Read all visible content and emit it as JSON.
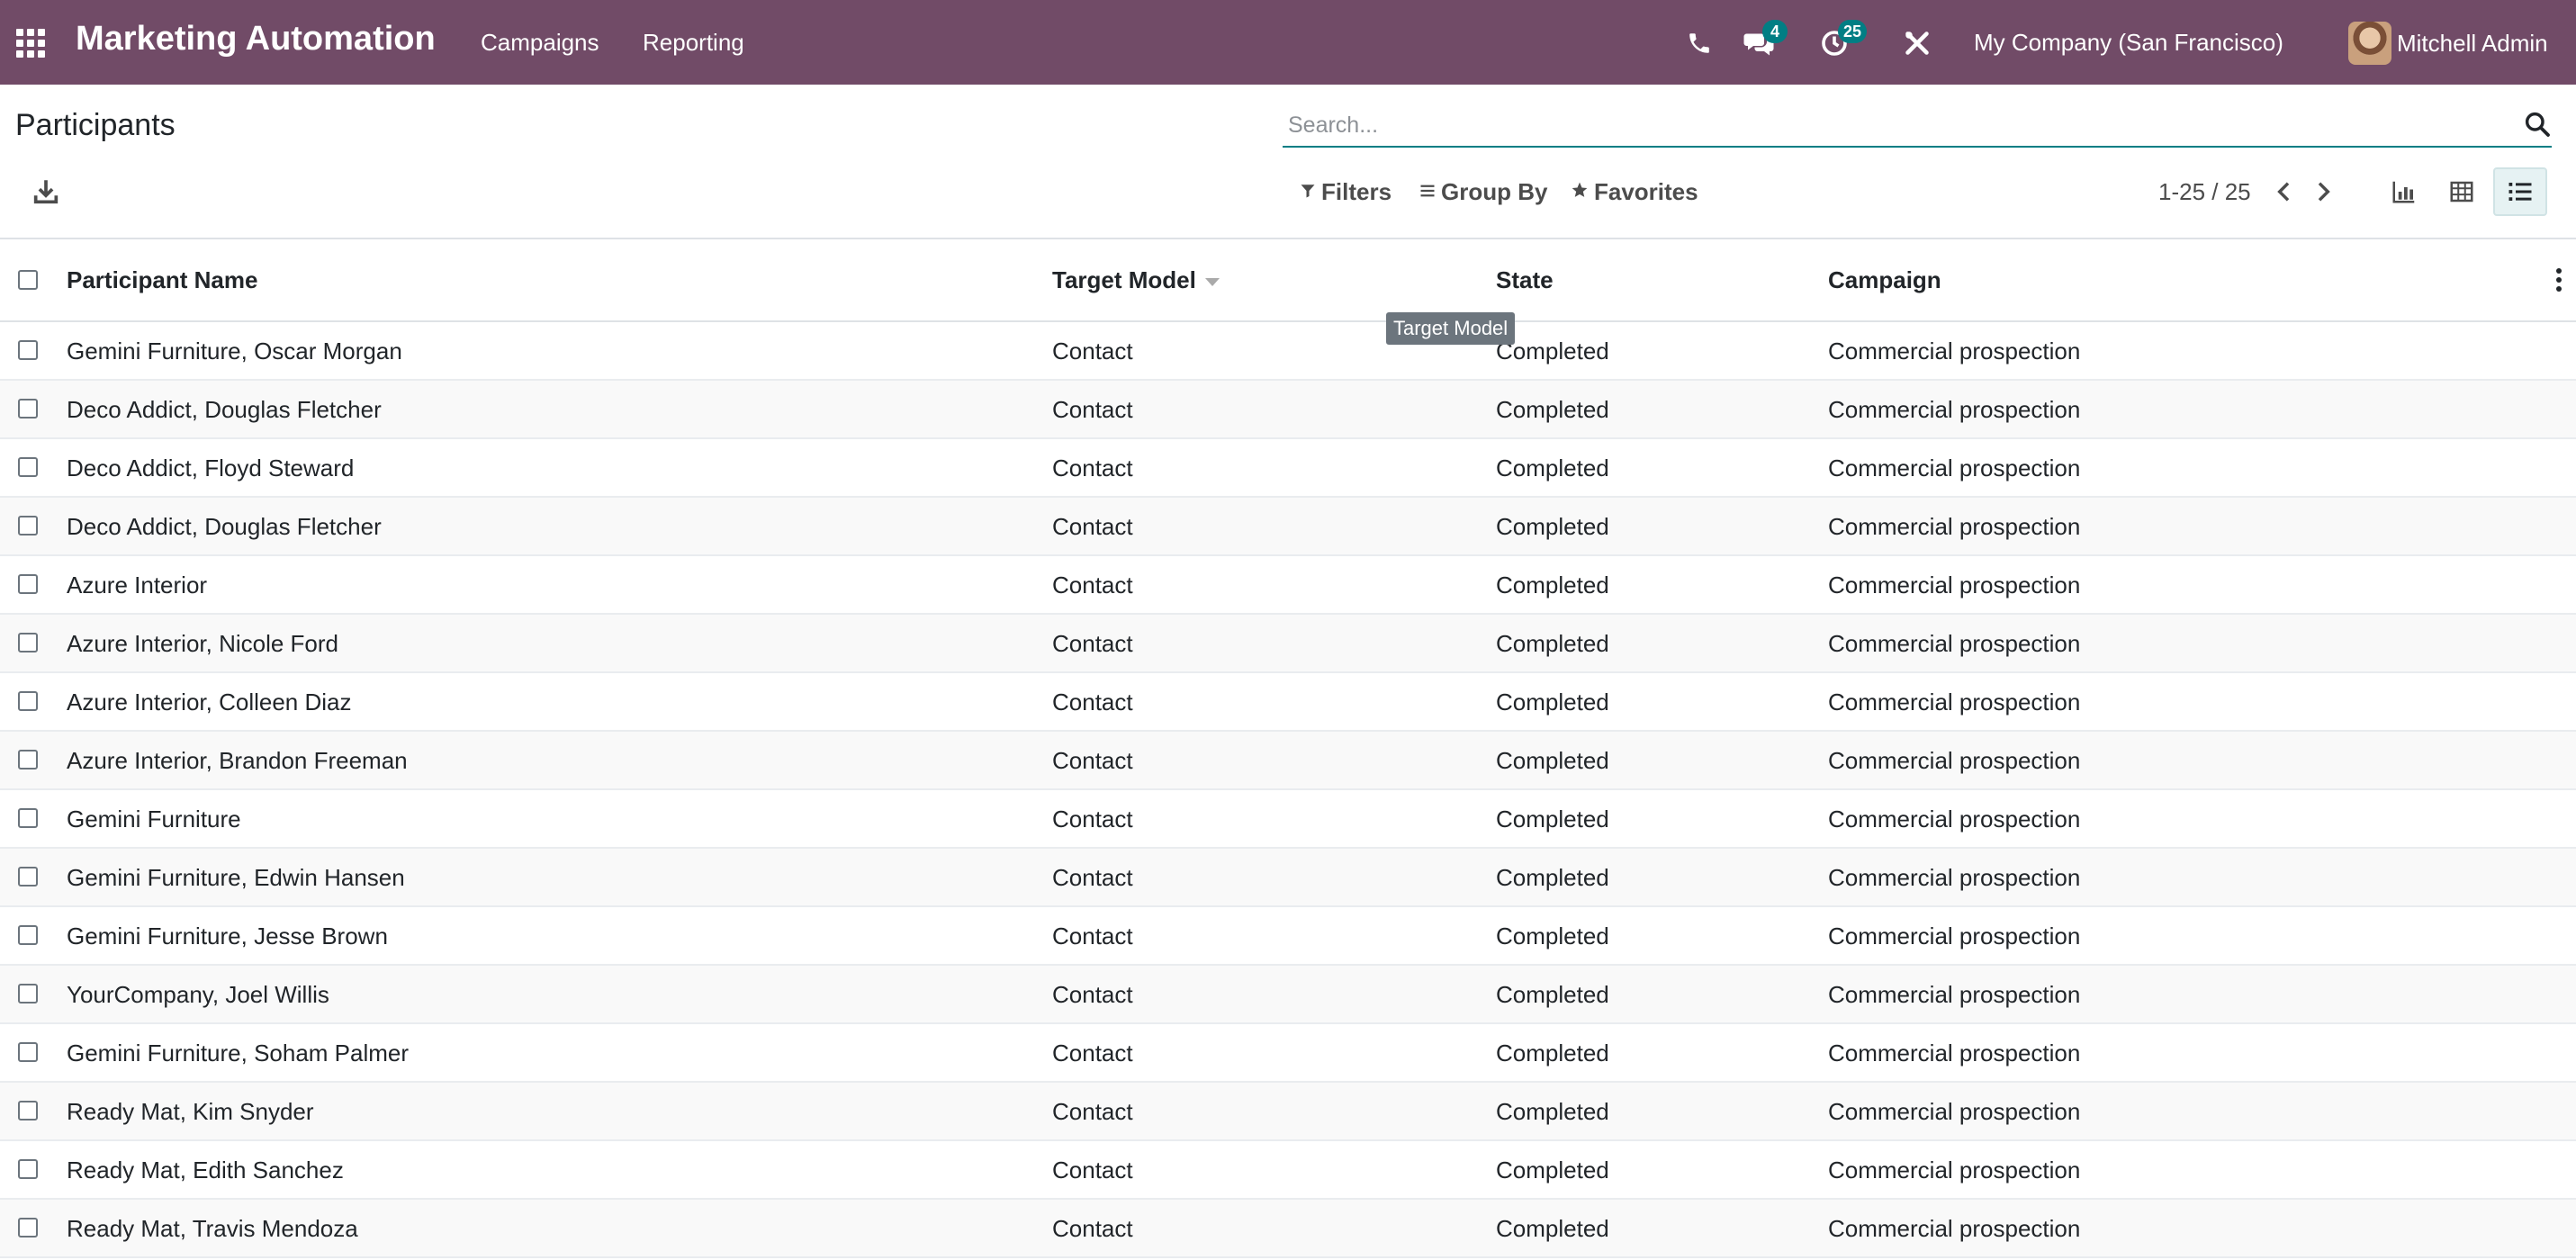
{
  "navbar": {
    "app_title": "Marketing Automation",
    "menus": [
      "Campaigns",
      "Reporting"
    ],
    "messages_badge": "4",
    "activities_badge": "25",
    "company": "My Company (San Francisco)",
    "user_name": "Mitchell Admin",
    "background_color": "#714B67"
  },
  "page": {
    "title": "Participants"
  },
  "search": {
    "placeholder": "Search...",
    "value": ""
  },
  "control_panel": {
    "filters_label": "Filters",
    "group_by_label": "Group By",
    "favorites_label": "Favorites",
    "pager_value": "1-25 / 25",
    "active_view": "list"
  },
  "table": {
    "columns": [
      "Participant Name",
      "Target Model",
      "State",
      "Campaign"
    ],
    "rows": [
      {
        "name": "Gemini Furniture, Oscar Morgan",
        "model": "Contact",
        "state": "Completed",
        "campaign": "Commercial prospection"
      },
      {
        "name": "Deco Addict, Douglas Fletcher",
        "model": "Contact",
        "state": "Completed",
        "campaign": "Commercial prospection"
      },
      {
        "name": "Deco Addict, Floyd Steward",
        "model": "Contact",
        "state": "Completed",
        "campaign": "Commercial prospection"
      },
      {
        "name": "Deco Addict, Douglas Fletcher",
        "model": "Contact",
        "state": "Completed",
        "campaign": "Commercial prospection"
      },
      {
        "name": "Azure Interior",
        "model": "Contact",
        "state": "Completed",
        "campaign": "Commercial prospection"
      },
      {
        "name": "Azure Interior, Nicole Ford",
        "model": "Contact",
        "state": "Completed",
        "campaign": "Commercial prospection"
      },
      {
        "name": "Azure Interior, Colleen Diaz",
        "model": "Contact",
        "state": "Completed",
        "campaign": "Commercial prospection"
      },
      {
        "name": "Azure Interior, Brandon Freeman",
        "model": "Contact",
        "state": "Completed",
        "campaign": "Commercial prospection"
      },
      {
        "name": "Gemini Furniture",
        "model": "Contact",
        "state": "Completed",
        "campaign": "Commercial prospection"
      },
      {
        "name": "Gemini Furniture, Edwin Hansen",
        "model": "Contact",
        "state": "Completed",
        "campaign": "Commercial prospection"
      },
      {
        "name": "Gemini Furniture, Jesse Brown",
        "model": "Contact",
        "state": "Completed",
        "campaign": "Commercial prospection"
      },
      {
        "name": "YourCompany, Joel Willis",
        "model": "Contact",
        "state": "Completed",
        "campaign": "Commercial prospection"
      },
      {
        "name": "Gemini Furniture, Soham Palmer",
        "model": "Contact",
        "state": "Completed",
        "campaign": "Commercial prospection"
      },
      {
        "name": "Ready Mat, Kim Snyder",
        "model": "Contact",
        "state": "Completed",
        "campaign": "Commercial prospection"
      },
      {
        "name": "Ready Mat, Edith Sanchez",
        "model": "Contact",
        "state": "Completed",
        "campaign": "Commercial prospection"
      },
      {
        "name": "Ready Mat, Travis Mendoza",
        "model": "Contact",
        "state": "Completed",
        "campaign": "Commercial prospection"
      }
    ]
  },
  "tooltip": {
    "text": "Target Model"
  }
}
